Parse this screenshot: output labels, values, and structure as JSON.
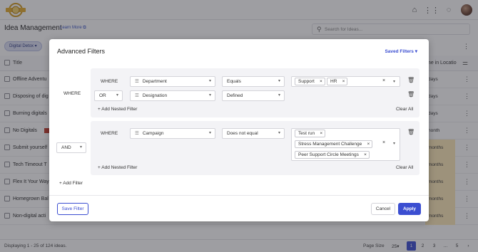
{
  "app": {
    "page_title": "Idea Management",
    "learn_more": "Learn More",
    "search_placeholder": "Search for Ideas...",
    "filter_chip": "Digital Detox",
    "colors": {
      "accent": "#3b4ed1",
      "highlight": "#fde9b8"
    }
  },
  "table": {
    "col_title": "Title",
    "col_location": "me in Locatio",
    "rows": [
      {
        "title": "Offline Adventu",
        "loc": "days"
      },
      {
        "title": "Disposing of dig",
        "loc": "days"
      },
      {
        "title": "Burning digitals",
        "loc": "days"
      },
      {
        "title": "No Digitals",
        "loc": "nonth"
      },
      {
        "title": "Submit yourself",
        "loc": "months"
      },
      {
        "title": "Tech Timeout T",
        "loc": "months"
      },
      {
        "title": "Flex It Your Way",
        "loc": "months"
      },
      {
        "title": "Homegrown Bal",
        "loc": "months"
      },
      {
        "title": "Non-digital acti",
        "loc": "months"
      }
    ]
  },
  "footer": {
    "displaying": "Displaying 1 - 25 of 124 ideas.",
    "page_size_label": "Page Size",
    "page_size_value": "25",
    "pages": [
      "1",
      "2",
      "3",
      "..."
    ],
    "pages_next": "5"
  },
  "modal": {
    "title": "Advanced Filters",
    "saved_filters": "Saved Filters",
    "group_where": "WHERE",
    "group_connector": "AND",
    "group1": {
      "row1": {
        "where": "WHERE",
        "field": "Department",
        "operator": "Equals",
        "values": [
          "Support",
          "HR"
        ]
      },
      "row2": {
        "where": "OR",
        "field": "Designation",
        "operator": "Defined"
      },
      "add_nested": "Add Nested Filter",
      "clear_all": "Clear All"
    },
    "group2": {
      "row1": {
        "where": "WHERE",
        "field": "Campaign",
        "operator": "Does not equal",
        "values": [
          "Test run",
          "Stress Management Challenge",
          "Peer Support Circle Meetings"
        ]
      },
      "add_nested": "Add Nested Filter",
      "clear_all": "Clear All"
    },
    "add_filter": "Add Filter",
    "save_filter": "Save Filter",
    "cancel": "Cancel",
    "apply": "Apply"
  }
}
